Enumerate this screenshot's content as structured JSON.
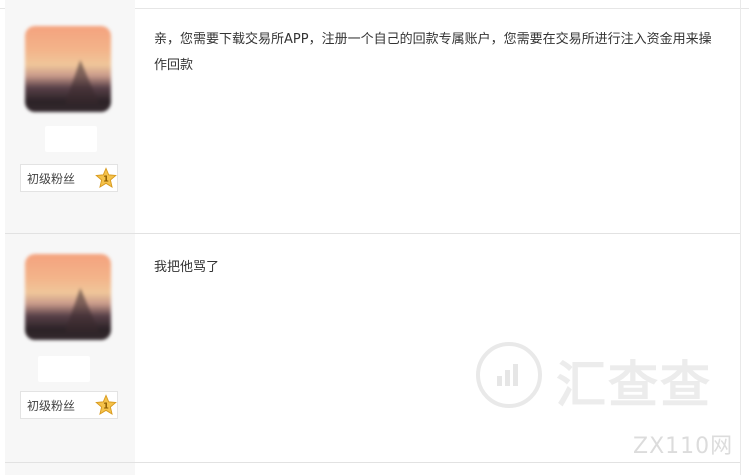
{
  "posts": [
    {
      "badge": "初级粉丝",
      "content": "亲，您需要下载交易所APP，注册一个自己的回款专属账户，您需要在交易所进行注入资金用来操作回款"
    },
    {
      "badge": "初级粉丝",
      "content": "我把他骂了"
    }
  ],
  "watermark": {
    "brand": "汇查查",
    "site": "ZX110网"
  },
  "colors": {
    "sidebar_bg": "#f7f7f7",
    "star": "#f5c24a",
    "text": "#333333"
  }
}
